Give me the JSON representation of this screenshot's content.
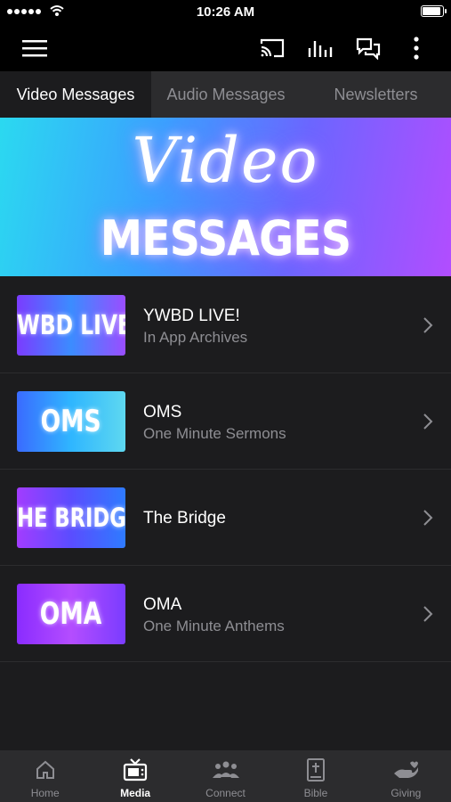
{
  "status_bar": {
    "time": "10:26 AM"
  },
  "tabs": [
    {
      "label": "Video Messages",
      "active": true
    },
    {
      "label": "Audio Messages",
      "active": false
    },
    {
      "label": "Newsletters",
      "active": false
    }
  ],
  "banner": {
    "script_text": "Video",
    "title": "MESSAGES"
  },
  "items": [
    {
      "thumb_text": "YWBD LIVE!",
      "title": "YWBD LIVE!",
      "subtitle": "In App Archives"
    },
    {
      "thumb_text": "OMS",
      "title": "OMS",
      "subtitle": "One Minute Sermons"
    },
    {
      "thumb_text": "THE BRIDGE",
      "title": "The Bridge",
      "subtitle": ""
    },
    {
      "thumb_text": "OMA",
      "title": "OMA",
      "subtitle": "One Minute Anthems"
    }
  ],
  "bottom_nav": [
    {
      "label": "Home",
      "icon": "home-icon",
      "active": false
    },
    {
      "label": "Media",
      "icon": "tv-icon",
      "active": true
    },
    {
      "label": "Connect",
      "icon": "people-icon",
      "active": false
    },
    {
      "label": "Bible",
      "icon": "bible-icon",
      "active": false
    },
    {
      "label": "Giving",
      "icon": "giving-hand-icon",
      "active": false
    }
  ],
  "colors": {
    "background": "#1c1c1e",
    "bar": "#000000",
    "tab_bar": "#2c2c2e",
    "muted_text": "#8e8e93"
  }
}
